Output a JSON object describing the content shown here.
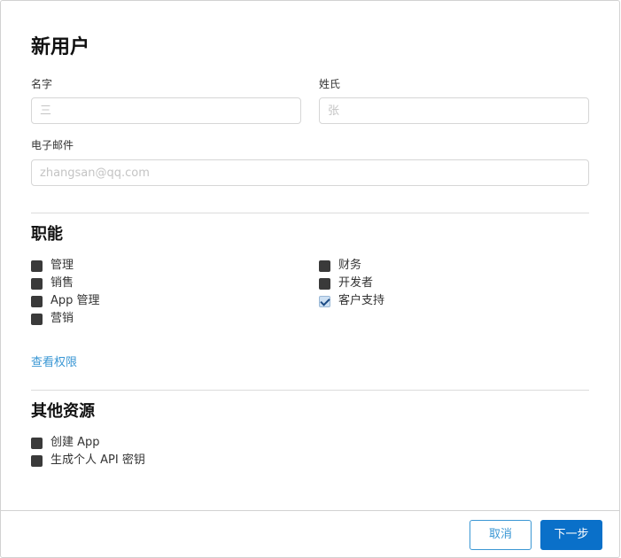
{
  "dialog": {
    "title": "新用户"
  },
  "form": {
    "first_name": {
      "label": "名字",
      "value": "",
      "placeholder": "三"
    },
    "last_name": {
      "label": "姓氏",
      "value": "",
      "placeholder": "张"
    },
    "email": {
      "label": "电子邮件",
      "value": "",
      "placeholder": "zhangsan@qq.com"
    }
  },
  "roles": {
    "title": "职能",
    "items": [
      {
        "label": "管理",
        "checked": false
      },
      {
        "label": "销售",
        "checked": false
      },
      {
        "label": "App 管理",
        "checked": false
      },
      {
        "label": "营销",
        "checked": false
      },
      {
        "label": "财务",
        "checked": false
      },
      {
        "label": "开发者",
        "checked": false
      },
      {
        "label": "客户支持",
        "checked": true
      }
    ],
    "view_permissions_link": "查看权限"
  },
  "other_resources": {
    "title": "其他资源",
    "items": [
      {
        "label": "创建 App",
        "checked": false
      },
      {
        "label": "生成个人 API 密钥",
        "checked": false
      }
    ]
  },
  "footer": {
    "cancel_label": "取消",
    "next_label": "下一步"
  },
  "colors": {
    "accent": "#0a70c9",
    "link": "#3a97d4",
    "checkbox_dark": "#3a3a3a"
  }
}
